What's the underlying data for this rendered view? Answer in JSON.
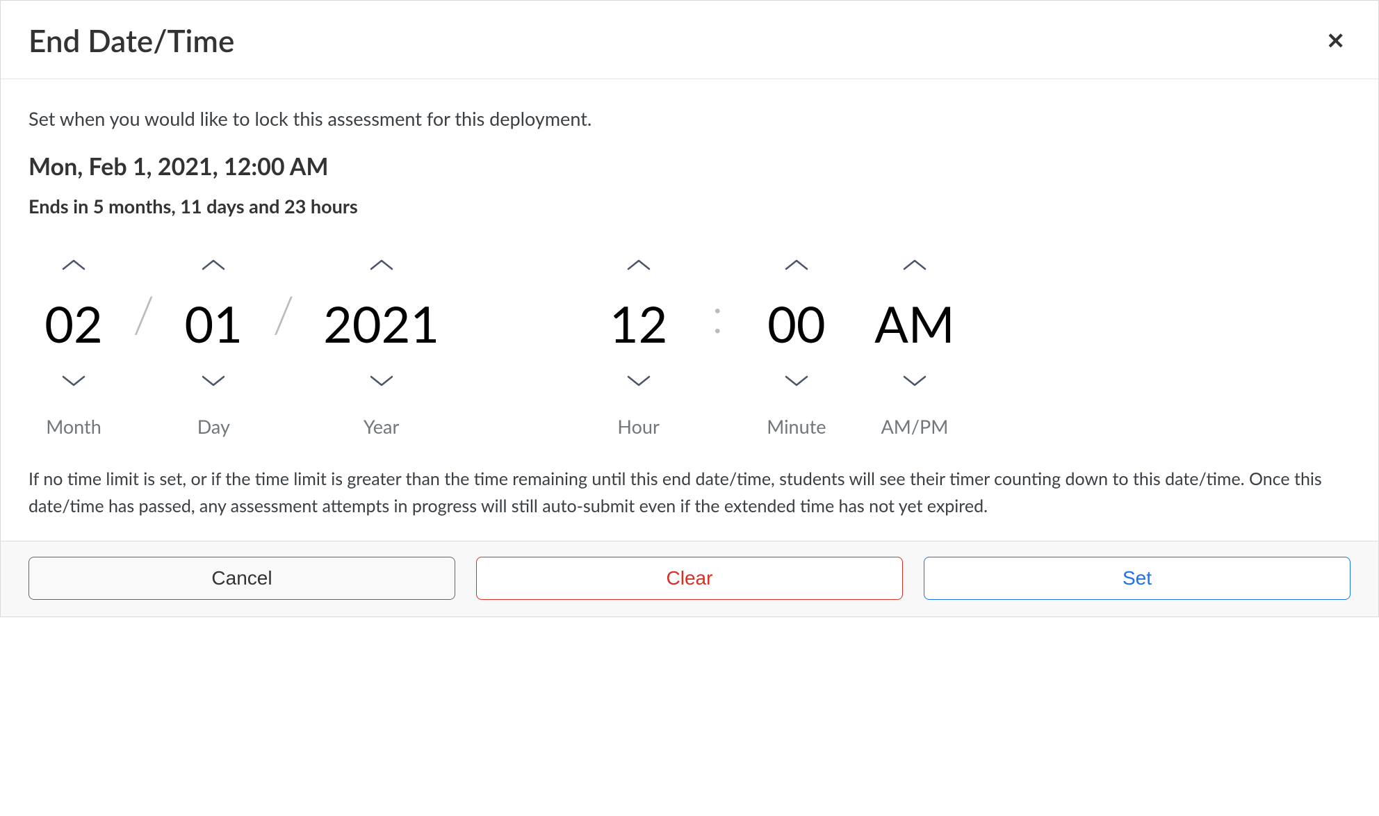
{
  "dialog": {
    "title": "End Date/Time"
  },
  "body": {
    "intro": "Set when you would like to lock this assessment for this deployment.",
    "selected_date": "Mon, Feb 1, 2021, 12:00 AM",
    "ends_in": "Ends in 5 months, 11 days and 23 hours",
    "note": "If no time limit is set, or if the time limit is greater than the time remaining until this end date/time, students will see their timer counting down to this date/time. Once this date/time has passed, any assessment attempts in progress will still auto-submit even if the extended time has not yet expired."
  },
  "picker": {
    "month": {
      "value": "02",
      "label": "Month"
    },
    "day": {
      "value": "01",
      "label": "Day"
    },
    "year": {
      "value": "2021",
      "label": "Year"
    },
    "hour": {
      "value": "12",
      "label": "Hour"
    },
    "minute": {
      "value": "00",
      "label": "Minute"
    },
    "ampm": {
      "value": "AM",
      "label": "AM/PM"
    },
    "date_sep": "/",
    "time_sep": ":"
  },
  "footer": {
    "cancel": "Cancel",
    "clear": "Clear",
    "set": "Set"
  }
}
